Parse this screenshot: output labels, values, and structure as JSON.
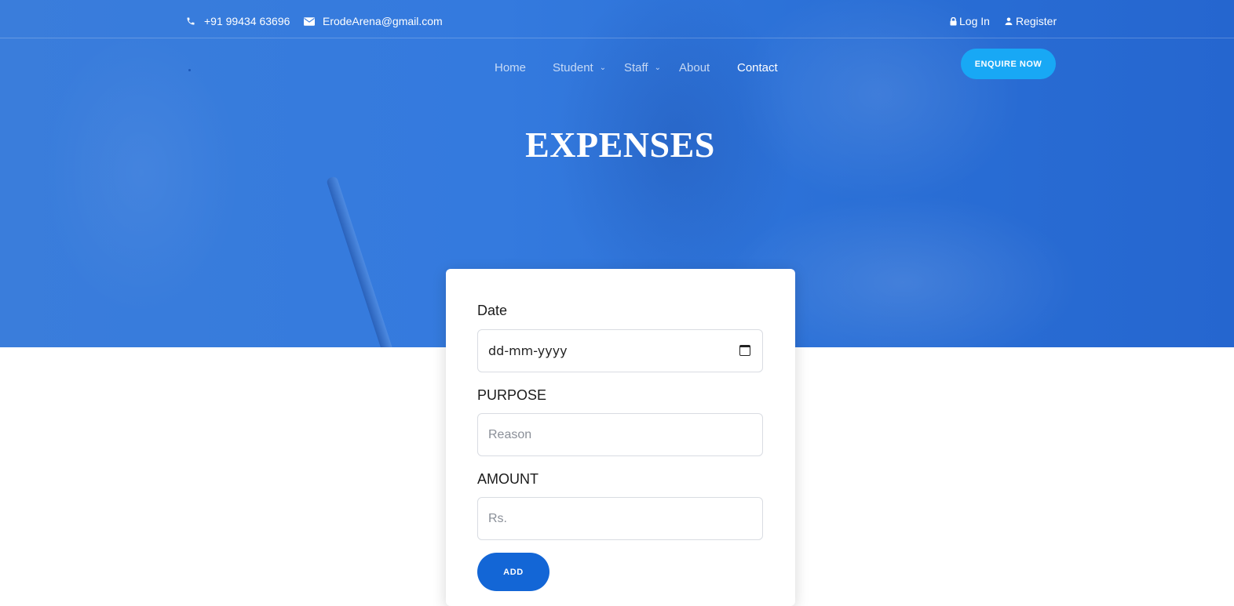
{
  "topbar": {
    "phone": "+91 99434 63696",
    "email": "ErodeArena@gmail.com",
    "login": "Log In",
    "register": "Register"
  },
  "nav": {
    "home": "Home",
    "student": "Student",
    "staff": "Staff",
    "about": "About",
    "contact": "Contact",
    "enquire": "ENQUIRE NOW"
  },
  "page_title": "EXPENSES",
  "form": {
    "date_label": "Date",
    "date_value": "dd-mm-yyyy",
    "purpose_label": "PURPOSE",
    "purpose_placeholder": "Reason",
    "amount_label": "AMOUNT",
    "amount_placeholder": "Rs.",
    "add_label": "ADD"
  },
  "colors": {
    "hero_blue": "#347ade",
    "enquire_button": "#18a8f5",
    "add_button": "#1366d6"
  },
  "icons": [
    "phone-icon",
    "envelope-icon",
    "lock-icon",
    "user-icon",
    "chevron-down-icon",
    "calendar-icon"
  ]
}
